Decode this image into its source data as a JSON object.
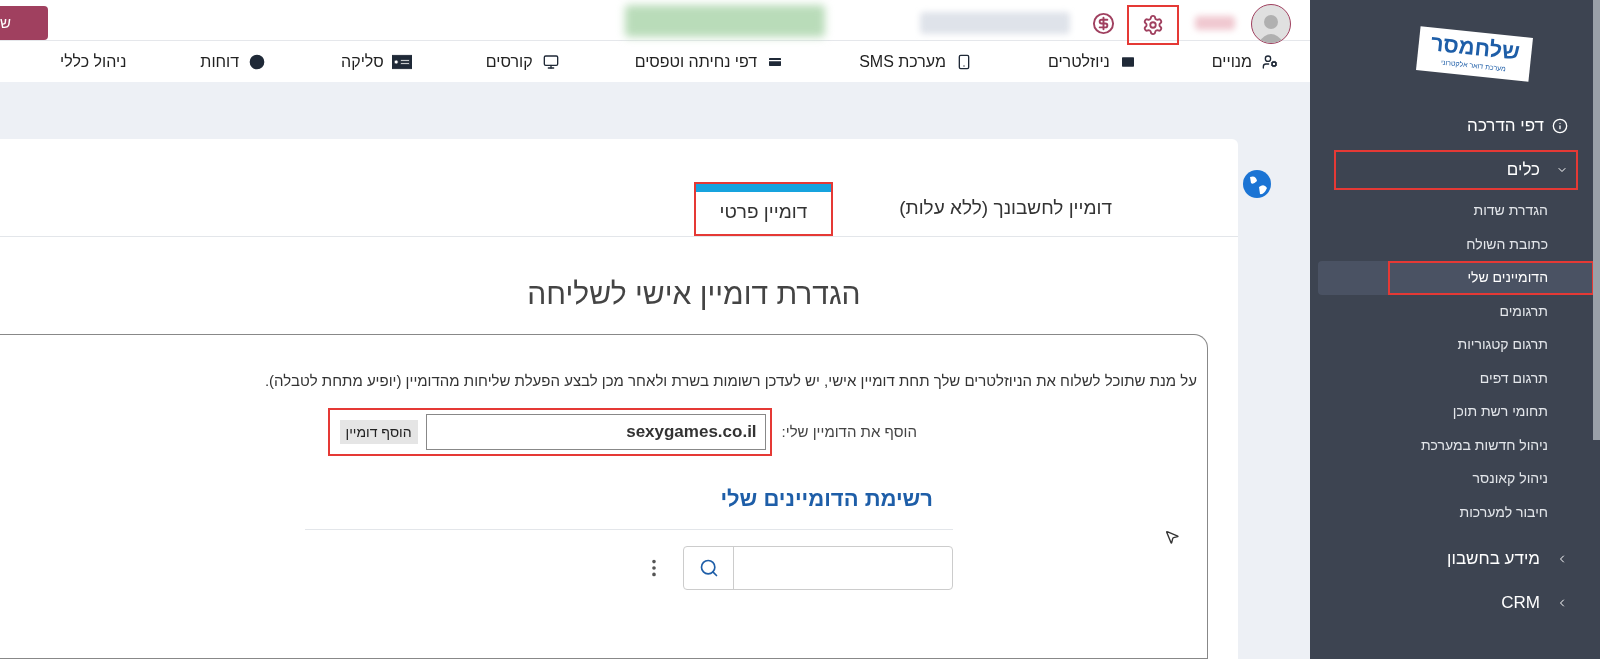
{
  "header": {
    "cut_button": "ש",
    "settings_highlighted": true
  },
  "nav": [
    {
      "label": "מנויים"
    },
    {
      "label": "ניוזלטרים"
    },
    {
      "label": "מערכת SMS"
    },
    {
      "label": "דפי נחיתה וטפסים"
    },
    {
      "label": "קורסים"
    },
    {
      "label": "סליקה"
    },
    {
      "label": "דוחות"
    },
    {
      "label": "ניהול כללי"
    }
  ],
  "sidebar": {
    "logo": {
      "name": "שלחמסר",
      "tagline": "מערכת דואר אלקטרוני"
    },
    "items": [
      {
        "label": "דפי הדרכה",
        "kind": "info",
        "highlighted": false
      },
      {
        "label": "כלים",
        "kind": "group",
        "expanded": true,
        "highlighted": true,
        "children": [
          {
            "label": "הגדרת שדות",
            "selected": false,
            "highlighted": false
          },
          {
            "label": "כתובת השולח",
            "selected": false,
            "highlighted": false
          },
          {
            "label": "הדומיינים שלי",
            "selected": true,
            "highlighted": true
          },
          {
            "label": "תרגומים",
            "selected": false,
            "highlighted": false
          },
          {
            "label": "תרגום קטגוריות",
            "selected": false,
            "highlighted": false
          },
          {
            "label": "תרגום דפים",
            "selected": false,
            "highlighted": false
          },
          {
            "label": "תחומי רשת תוכן",
            "selected": false,
            "highlighted": false
          },
          {
            "label": "ניהול חדשות במערכת",
            "selected": false,
            "highlighted": false
          },
          {
            "label": "ניהול קאונסר",
            "selected": false,
            "highlighted": false
          },
          {
            "label": "חיבור למערכות",
            "selected": false,
            "highlighted": false
          }
        ]
      },
      {
        "label": "מידע בחשבון",
        "kind": "group",
        "expanded": false,
        "highlighted": false
      },
      {
        "label": "CRM",
        "kind": "group",
        "expanded": false,
        "highlighted": false
      }
    ]
  },
  "tabs": [
    {
      "label": "דומיין לחשבונך (ללא עלות)",
      "selected": false,
      "highlighted": false
    },
    {
      "label": "דומיין פרטי",
      "selected": true,
      "highlighted": true
    }
  ],
  "page_title": "הגדרת דומיין אישי לשליחה",
  "instructions": "על מנת שתוכל לשלוח את הניוזלטרים שלך תחת דומיין אישי, יש לעדכן רשומות בשרת ולאחר מכן לבצע הפעלת שליחות מהדומיין (יופיע מתחת לטבלה).",
  "domain_form": {
    "label": "הוסף את הדומיין שלי:",
    "value": "sexygames.co.il",
    "button": "הוסף דומיין",
    "highlighted": true
  },
  "list_title": "רשימת הדומיינים שלי"
}
